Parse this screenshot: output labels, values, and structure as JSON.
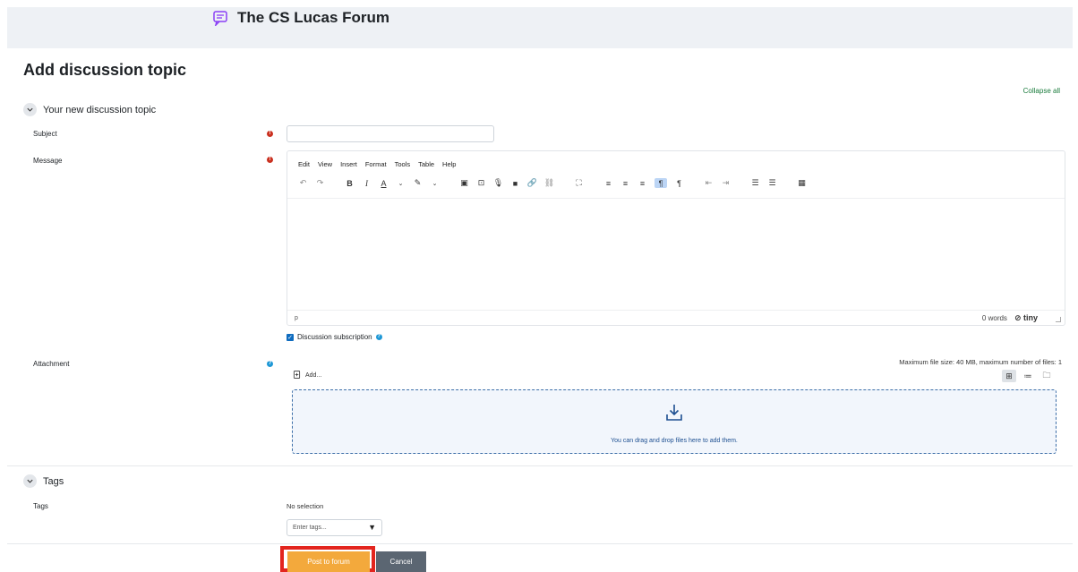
{
  "forum": {
    "title": "The CS Lucas Forum"
  },
  "page": {
    "heading": "Add discussion topic",
    "collapse_all": "Collapse all"
  },
  "sections": {
    "topic": {
      "label": "Your new discussion topic"
    },
    "tags": {
      "label": "Tags"
    }
  },
  "fields": {
    "subject": {
      "label": "Subject",
      "value": "",
      "required": true
    },
    "message": {
      "label": "Message",
      "required": true
    },
    "attachment": {
      "label": "Attachment"
    },
    "tags": {
      "label": "Tags",
      "selection": "No selection",
      "placeholder": "Enter tags..."
    }
  },
  "editor": {
    "menus": [
      "Edit",
      "View",
      "Insert",
      "Format",
      "Tools",
      "Table",
      "Help"
    ],
    "path": "p",
    "word_count": "0 words",
    "brand": "tiny",
    "toolbar_icons": [
      "undo-icon",
      "redo-icon",
      "bold-icon",
      "italic-icon",
      "text-color-icon",
      "highlight-icon",
      "image-icon",
      "media-icon",
      "record-audio-icon",
      "record-video-icon",
      "link-icon",
      "unlink-icon",
      "fullscreen-icon",
      "align-left-icon",
      "align-center-icon",
      "align-right-icon",
      "ltr-icon",
      "rtl-icon",
      "outdent-icon",
      "indent-icon",
      "bullet-list-icon",
      "numbered-list-icon",
      "calculator-icon"
    ]
  },
  "subscription": {
    "label": "Discussion subscription",
    "checked": true
  },
  "filepicker": {
    "limits": "Maximum file size: 40 MB, maximum number of files: 1",
    "add_label": "Add...",
    "dropzone_text": "You can drag and drop files here to add them."
  },
  "buttons": {
    "post": "Post to forum",
    "cancel": "Cancel"
  },
  "colors": {
    "accent_green": "#1a7b3c",
    "required_red": "#ca3120",
    "info_blue": "#1f98d6",
    "post_orange": "#f3a93c",
    "highlight_red": "#e3251e"
  }
}
